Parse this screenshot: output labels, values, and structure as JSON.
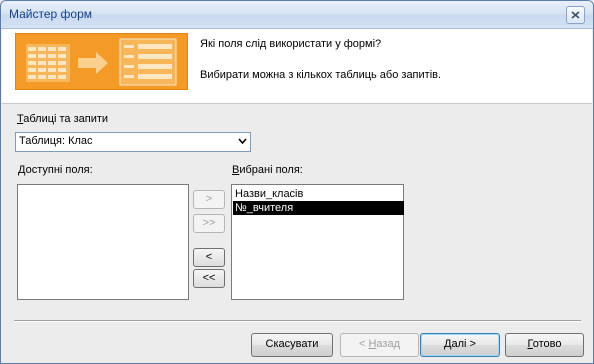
{
  "window": {
    "title": "Майстер форм"
  },
  "header": {
    "question": "Які поля слід використати у формі?",
    "hint": "Вибирати можна з кількох таблиць або запитів."
  },
  "source": {
    "label_underlined": "Т",
    "label_rest": "аблиці та запити",
    "selected": "Таблиця: Клас"
  },
  "available": {
    "label_underlined": "Д",
    "label_rest": "оступні поля:",
    "items": []
  },
  "selected_fields": {
    "label_underlined": "В",
    "label_rest": "ибрані поля:",
    "items": [
      "Назви_класів",
      "№_вчителя"
    ],
    "highlighted_index": 1
  },
  "move_buttons": {
    "add_one": ">",
    "add_all": ">>",
    "remove_one": "<",
    "remove_all": "<<"
  },
  "buttons": {
    "cancel": "Скасувати",
    "back_arrow": "< ",
    "back_underlined": "Н",
    "back_rest": "азад",
    "next_underlined": "Д",
    "next_rest": "алі >",
    "finish_underlined": "Г",
    "finish_rest": "отово"
  },
  "colors": {
    "banner": "#f39b26",
    "title_text": "#15428b",
    "selection": "#000000"
  },
  "icons": {
    "close": "close-icon",
    "dropdown": "chevron-down-icon",
    "banner": "form-wizard-illustration"
  }
}
